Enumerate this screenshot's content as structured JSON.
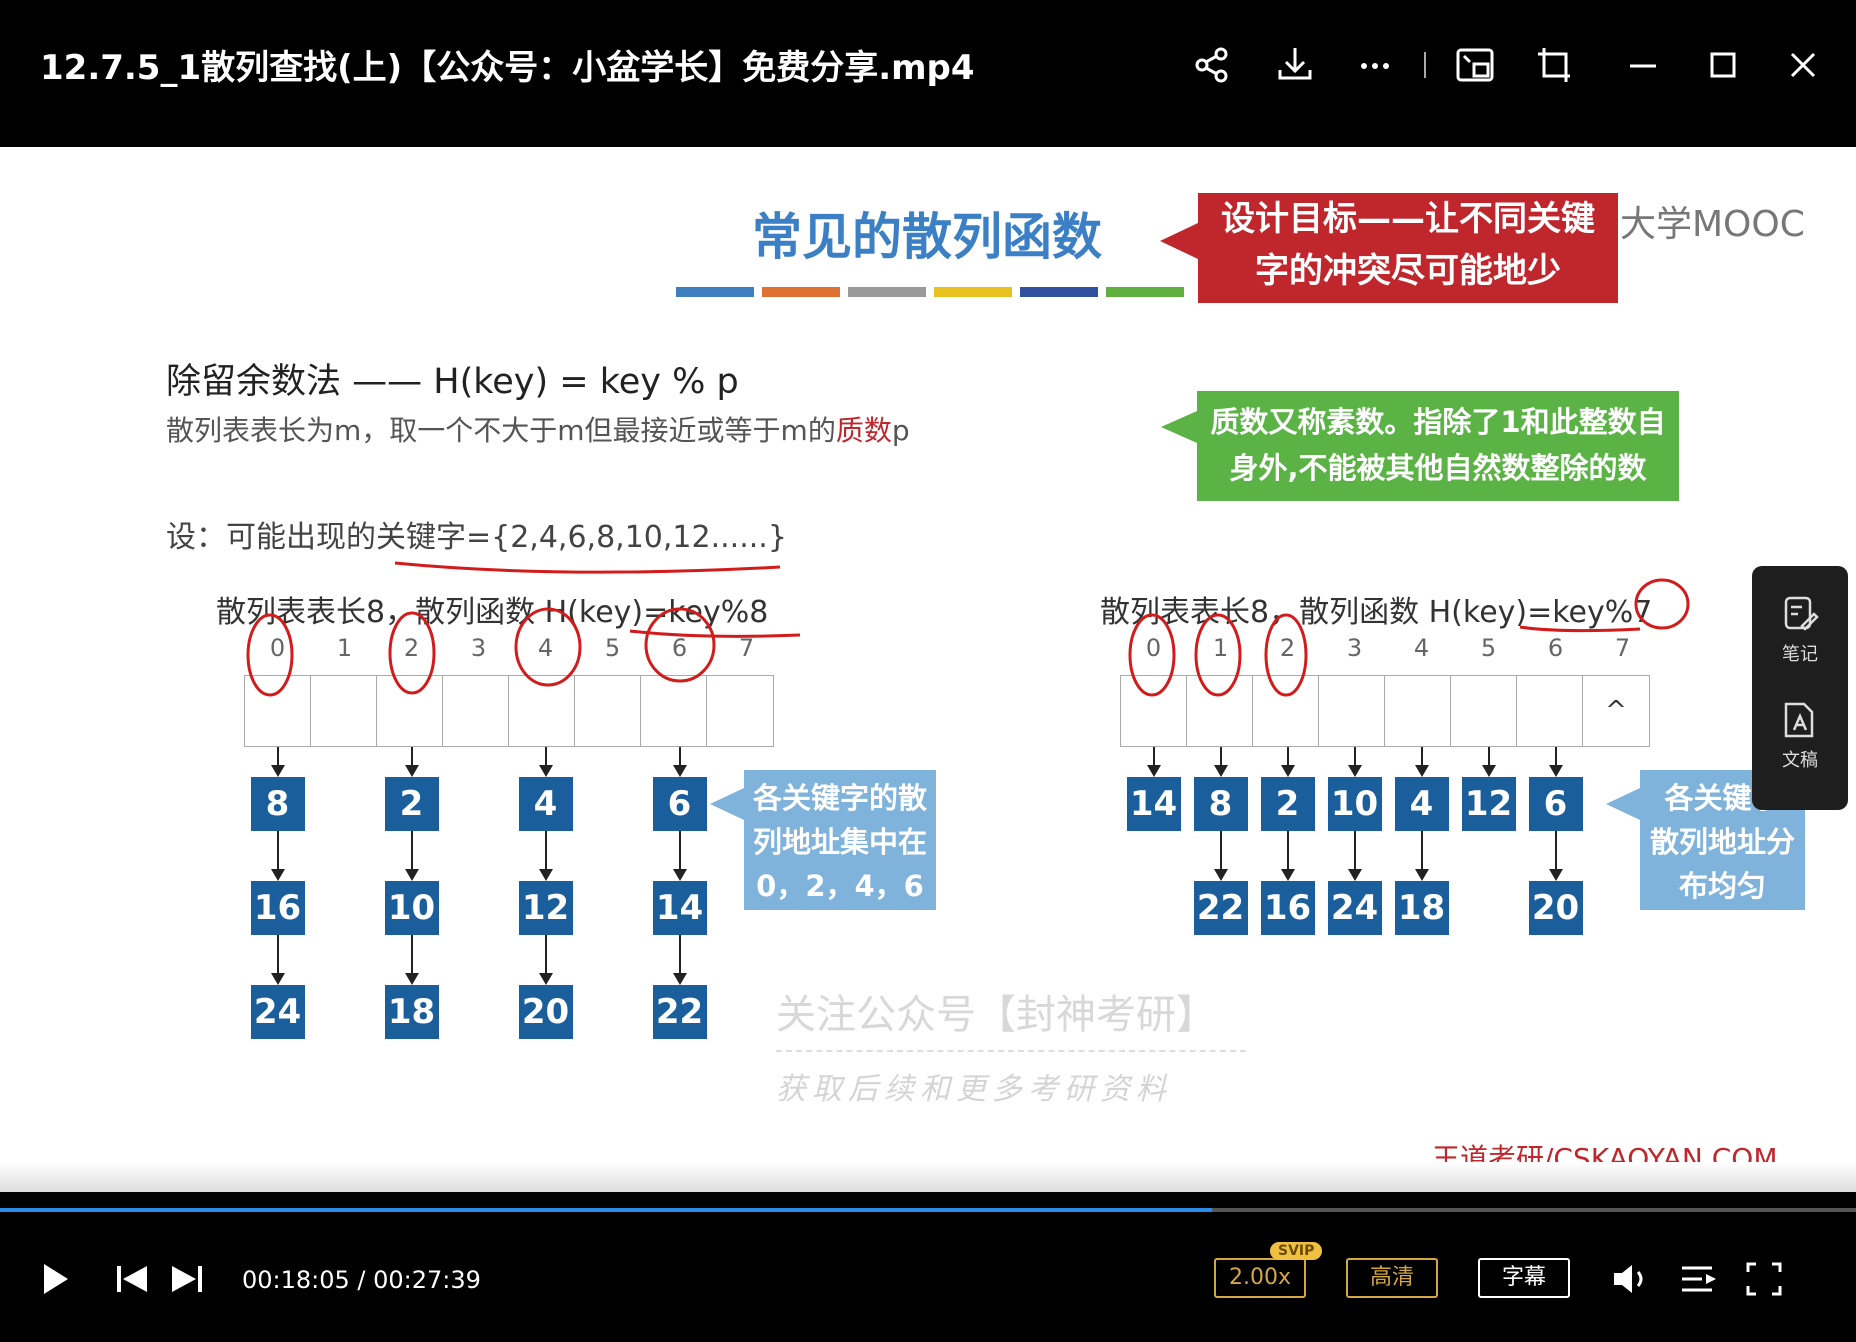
{
  "window": {
    "title": "12.7.5_1散列查找(上)【公众号：小盆学长】免费分享.mp4"
  },
  "slide": {
    "title": "常见的散列函数",
    "mooc": "大学MOOC",
    "colorbar": [
      "#3f7fc0",
      "#e07030",
      "#999999",
      "#e8c020",
      "#3050a0",
      "#60b040"
    ],
    "callout_red": [
      "设计目标——让不同关键",
      "字的冲突尽可能地少"
    ],
    "method": "除留余数法 —— H(key) = key % p",
    "desc_before": "散列表表长为m，取一个不大于m但最接近或等于m的",
    "desc_em": "质数",
    "desc_after": "p",
    "callout_green": [
      "质数又称素数。指除了1和此整数自",
      "身外,不能被其他自然数整除的数"
    ],
    "keys": "设：可能出现的关键字={2,4,6,8,10,12......}",
    "left": {
      "heading": "散列表表长8，散列函数 H(key)=key%8",
      "indices": [
        "0",
        "1",
        "2",
        "3",
        "4",
        "5",
        "6",
        "7"
      ],
      "chains": [
        {
          "slot": 0,
          "values": [
            "8",
            "16",
            "24"
          ]
        },
        {
          "slot": 2,
          "values": [
            "2",
            "10",
            "18"
          ]
        },
        {
          "slot": 4,
          "values": [
            "4",
            "12",
            "20"
          ]
        },
        {
          "slot": 6,
          "values": [
            "6",
            "14",
            "22"
          ]
        }
      ],
      "callout": [
        "各关键字的散",
        "列地址集中在",
        "0，2，4，6"
      ]
    },
    "right": {
      "heading": "散列表表长8，散列函数 H(key)=key%7",
      "indices": [
        "0",
        "1",
        "2",
        "3",
        "4",
        "5",
        "6",
        "7"
      ],
      "slot7_mark": "^",
      "chains": [
        {
          "slot": 0,
          "values": [
            "14"
          ]
        },
        {
          "slot": 1,
          "values": [
            "8",
            "22"
          ]
        },
        {
          "slot": 2,
          "values": [
            "2",
            "16"
          ]
        },
        {
          "slot": 3,
          "values": [
            "10",
            "24"
          ]
        },
        {
          "slot": 4,
          "values": [
            "4",
            "18"
          ]
        },
        {
          "slot": 5,
          "values": [
            "12"
          ]
        },
        {
          "slot": 6,
          "values": [
            "6",
            "20"
          ]
        }
      ],
      "callout": [
        "各关键字",
        "散列地址分",
        "布均匀"
      ]
    },
    "watermark1": "关注公众号【封神考研】",
    "watermark2": "获取后续和更多考研资料",
    "credit": "王道考研/CSKAOYAN.COM"
  },
  "side_panel": {
    "notes_label": "笔记",
    "docs_label": "文稿"
  },
  "player": {
    "current_time": "00:18:05",
    "total_time": "00:27:39",
    "time_display": "00:18:05 / 00:27:39",
    "progress_percent": 65.3,
    "speed": "2.00x",
    "svip": "SVIP",
    "quality": "高清",
    "subtitle": "字幕"
  }
}
